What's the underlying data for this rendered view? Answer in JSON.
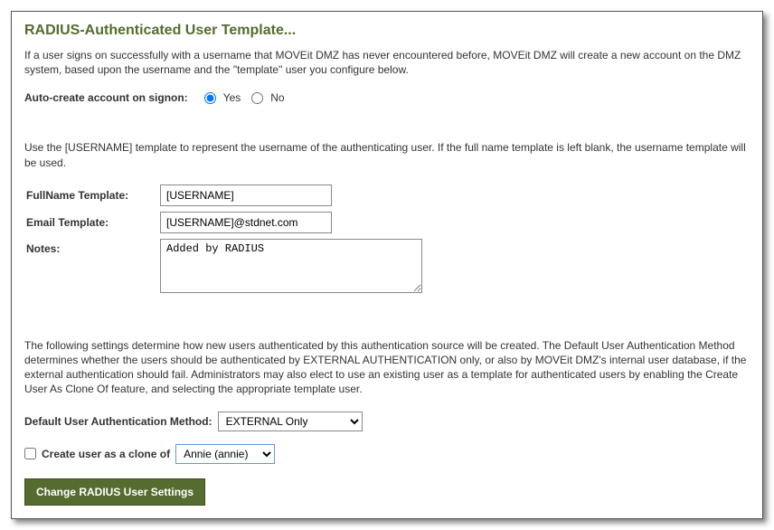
{
  "heading": "RADIUS-Authenticated User Template...",
  "intro_para": "If a user signs on successfully with a username that MOVEit DMZ has never encountered before, MOVEit DMZ will create a new account on the DMZ system, based upon the username and the \"template\" user you configure below.",
  "auto_create": {
    "label": "Auto-create account on signon:",
    "yes_label": "Yes",
    "no_label": "No",
    "selected": "yes"
  },
  "template_hint_para": "Use the [USERNAME] template to represent the username of the authenticating user. If the full name template is left blank, the username template will be used.",
  "fields": {
    "fullname_label": "FullName Template:",
    "fullname_value": "[USERNAME]",
    "email_label": "Email Template:",
    "email_value": "[USERNAME]@stdnet.com",
    "notes_label": "Notes:",
    "notes_value": "Added by RADIUS"
  },
  "auth_para": "The following settings determine how new users authenticated by this authentication source will be created. The Default User Authentication Method determines whether the users should be authenticated by EXTERNAL AUTHENTICATION only, or also by MOVEit DMZ's internal user database, if the external authentication should fail. Administrators may also elect to use an existing user as a template for authenticated users by enabling the Create User As Clone Of feature, and selecting the appropriate template user.",
  "auth_method": {
    "label": "Default User Authentication Method:",
    "value": "EXTERNAL Only",
    "options": [
      "EXTERNAL Only"
    ]
  },
  "clone": {
    "checkbox_label": "Create user as a clone of",
    "checked": false,
    "value": "Annie (annie)",
    "options": [
      "Annie (annie)"
    ]
  },
  "submit_label": "Change RADIUS User Settings"
}
